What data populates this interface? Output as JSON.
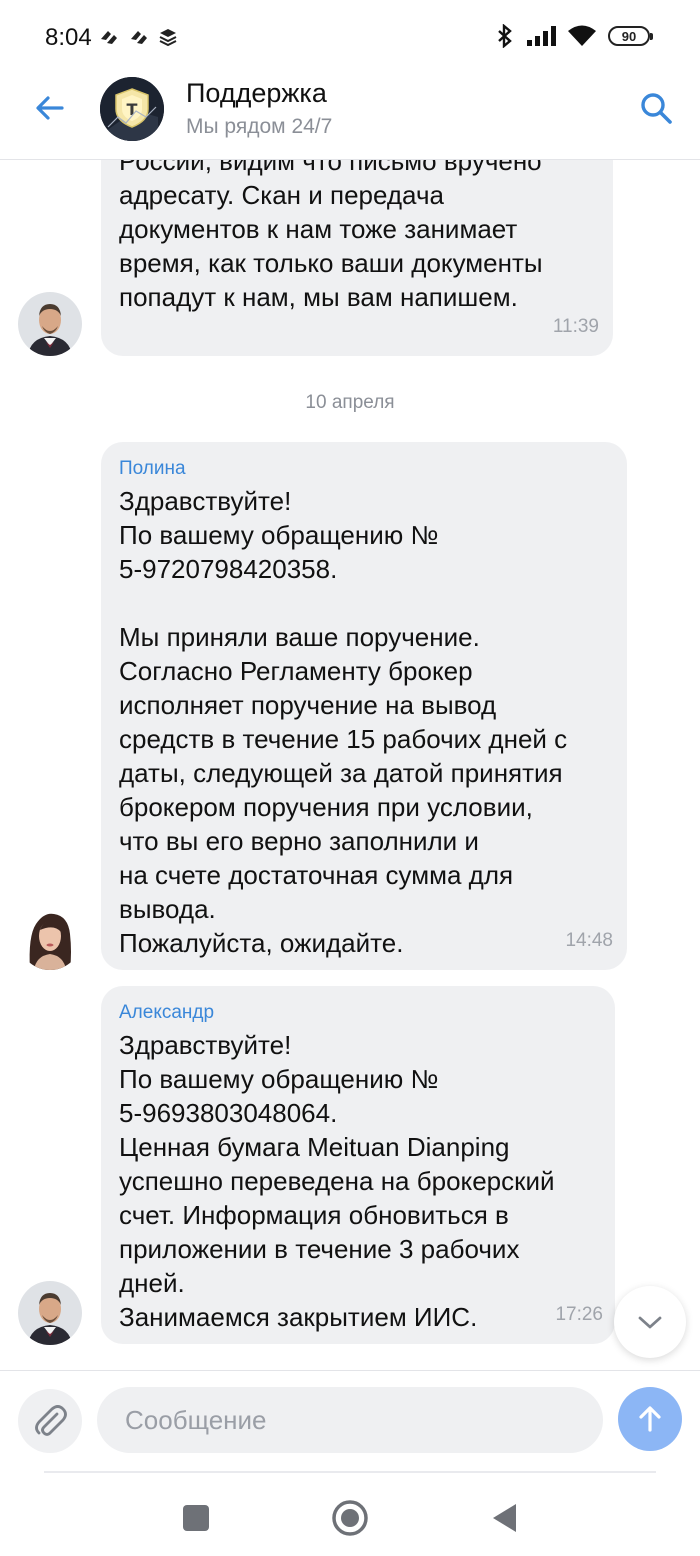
{
  "status_bar": {
    "time": "8:04",
    "battery": "90"
  },
  "header": {
    "title": "Поддержка",
    "subtitle": "Мы рядом 24/7"
  },
  "messages": [
    {
      "sender": "",
      "text": "России, видим что письмо вручено\nадресату. Скан и передача\nдокументов к нам тоже занимает\nвремя, как только ваши документы\nпопадут к нам, мы вам напишем.",
      "time": "11:39"
    },
    {
      "sender": "Полина",
      "text": "Здравствуйте!\nПо вашему обращению №\n5-9720798420358.\n\nМы приняли ваше поручение.\nСогласно Регламенту брокер\nисполняет поручение на вывод\nсредств в течение 15 рабочих дней с\nдаты, следующей за датой принятия\nброкером поручения при условии,\nчто вы его верно заполнили и\nна счете достаточная сумма для\nвывода.\nПожалуйста, ожидайте.",
      "time": "14:48"
    },
    {
      "sender": "Александр",
      "text": "Здравствуйте!\nПо вашему обращению №\n5-9693803048064.\nЦенная бумага Meituan Dianping\nуспешно переведена на брокерский\nсчет. Информация обновиться в\nприложении в течение 3 рабочих\nдней.\nЗанимаемся закрытием ИИС.",
      "time": "17:26"
    }
  ],
  "date_separator": "10 апреля",
  "composer": {
    "placeholder": "Сообщение"
  },
  "colors": {
    "accent": "#3a87d9",
    "bubble": "#eff0f2",
    "send_button": "#8cb6f5"
  },
  "icons": {
    "back": "arrow-left-icon",
    "search": "search-icon",
    "attach": "paperclip-icon",
    "send": "arrow-up-icon",
    "scroll": "chevron-down-icon"
  }
}
